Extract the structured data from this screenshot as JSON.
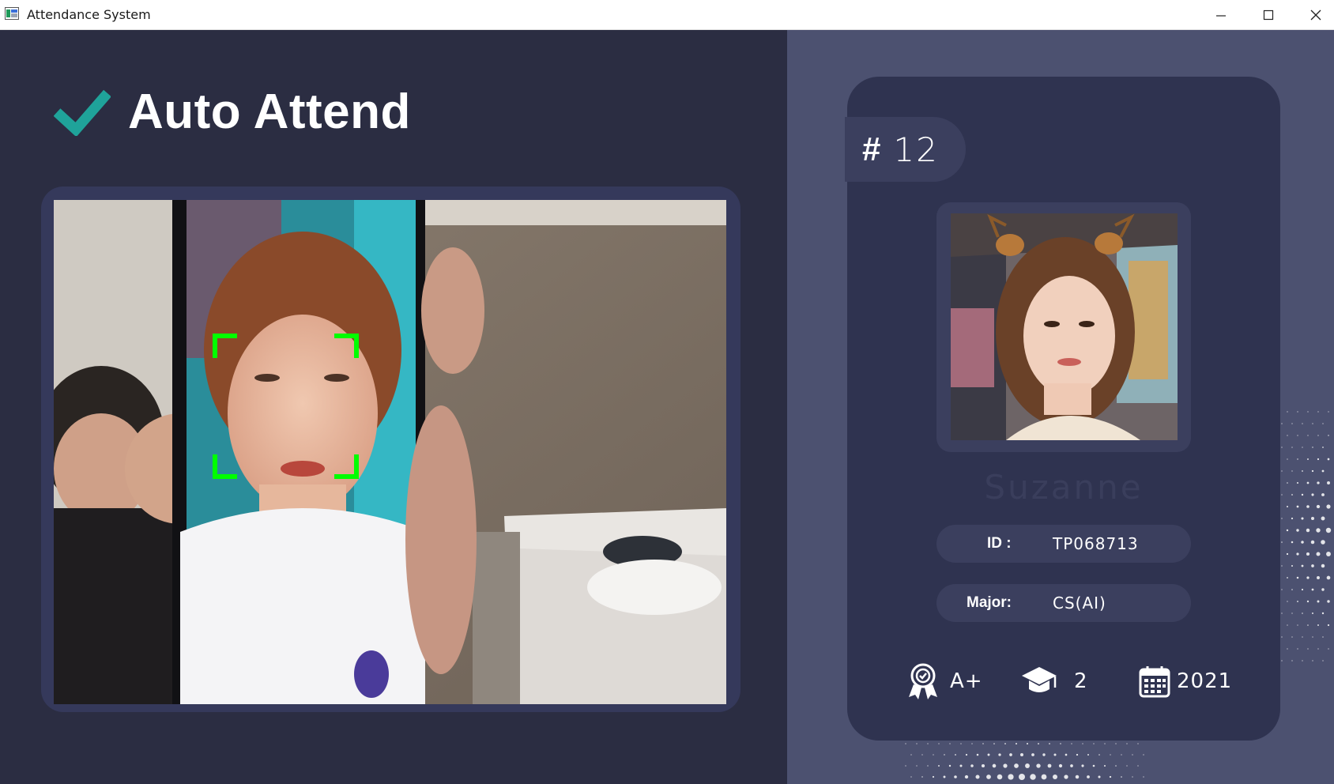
{
  "window": {
    "title": "Attendance System",
    "controls": {
      "minimize_icon": "minimize-icon",
      "maximize_icon": "maximize-icon",
      "close_icon": "close-icon"
    }
  },
  "header": {
    "title": "Auto Attend",
    "icon": "checkmark-icon",
    "accent_color": "#1fa39a"
  },
  "camera": {
    "feed_icon": "camera-feed",
    "detection_box_color": "#00ff00"
  },
  "profile": {
    "number_symbol": "#",
    "number": "12",
    "name": "Suzanne",
    "id_label": "ID :",
    "id_value": "TP068713",
    "major_label": "Major:",
    "major_value": "CS(AI)",
    "stats": [
      {
        "icon": "award-ribbon-icon",
        "value": "A+"
      },
      {
        "icon": "graduation-cap-icon",
        "value": "2"
      },
      {
        "icon": "calendar-icon",
        "value": "2021"
      }
    ]
  },
  "colors": {
    "left_background": "#2b2d42",
    "right_background": "#4c5170",
    "card_background": "#2f3350",
    "pill_background": "#3b3f5e"
  }
}
